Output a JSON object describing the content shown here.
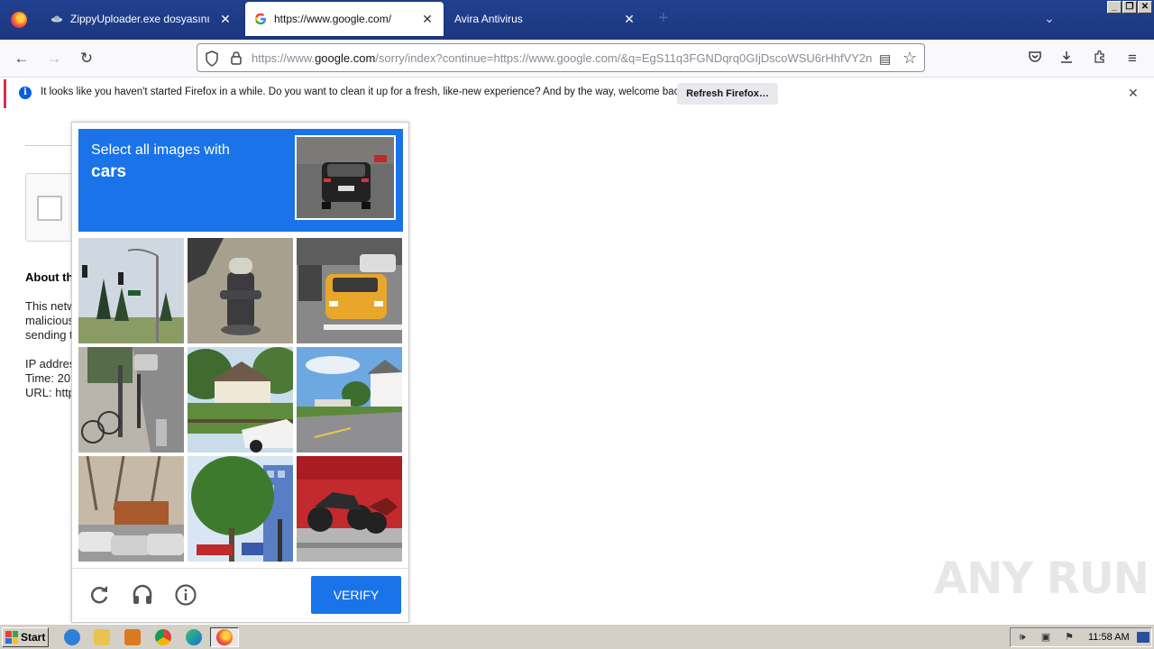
{
  "browser": {
    "tabs": [
      {
        "label": "ZippyUploader.exe dosyasını indir",
        "favicon": "zippy-icon",
        "active": false
      },
      {
        "label": "https://www.google.com/",
        "favicon": "google-g-icon",
        "active": true
      },
      {
        "label": "Avira Antivirus",
        "favicon": "",
        "active": false
      }
    ],
    "new_tab": "+",
    "url": {
      "prefix": "https://www.",
      "host": "google.com",
      "rest": "/sorry/index?continue=https://www.google.com/&q=EgS11q3FGNDqrq0GIjDscoWSU6rHhfVY2n"
    }
  },
  "notification": {
    "text": "It looks like you haven't started Firefox in a while. Do you want to clean it up for a fresh, like-new experience? And by the way, welcome back!",
    "button": "Refresh Firefox…"
  },
  "page": {
    "about_heading": "About th",
    "para1": [
      "This netw",
      "malicious",
      "sending t"
    ],
    "para2": [
      "IP addres",
      "Time: 20",
      "URL: http"
    ]
  },
  "captcha": {
    "instruction": "Select all images with",
    "target": "cars",
    "verify_label": "VERIFY",
    "tiles": [
      {
        "name": "tile-traffic-light-trees"
      },
      {
        "name": "tile-fire-hydrant"
      },
      {
        "name": "tile-yellow-taxi"
      },
      {
        "name": "tile-sidewalk-bicycle"
      },
      {
        "name": "tile-house-white-car"
      },
      {
        "name": "tile-road-houses"
      },
      {
        "name": "tile-parking-lot-cars"
      },
      {
        "name": "tile-tree-building"
      },
      {
        "name": "tile-motorcycles"
      }
    ]
  },
  "watermark": "ANY RUN",
  "taskbar": {
    "start_label": "Start",
    "clock": "11:58 AM"
  },
  "colors": {
    "captcha_blue": "#1a73e8",
    "notice_accent": "#e22850",
    "tabstrip": "#1f3b8a"
  }
}
